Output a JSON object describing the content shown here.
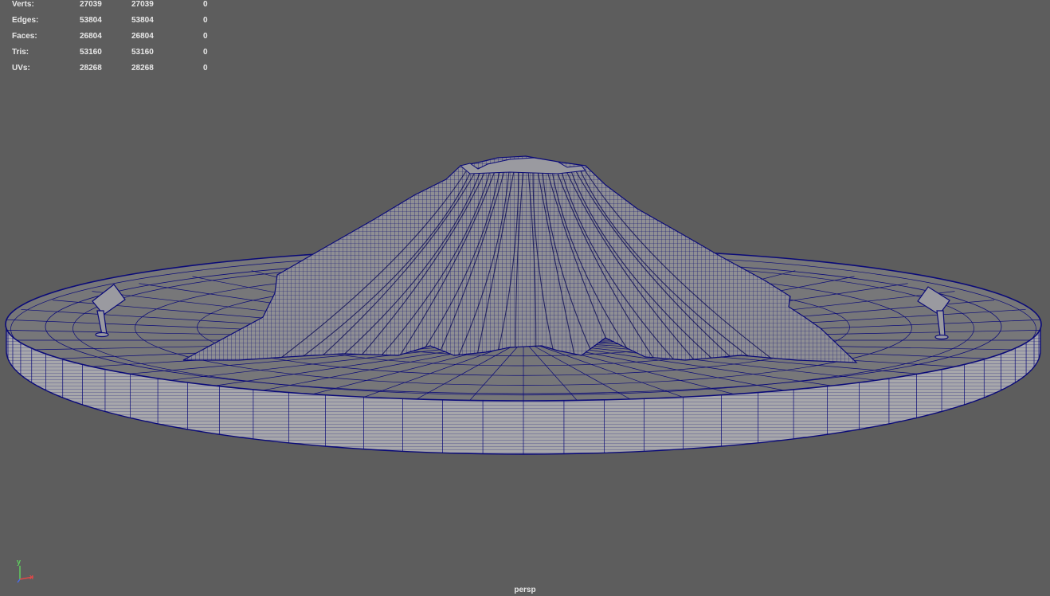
{
  "hud": {
    "rows": [
      {
        "label": "Verts:",
        "c1": "27039",
        "c2": "27039",
        "c3": "0"
      },
      {
        "label": "Edges:",
        "c1": "53804",
        "c2": "53804",
        "c3": "0"
      },
      {
        "label": "Faces:",
        "c1": "26804",
        "c2": "26804",
        "c3": "0"
      },
      {
        "label": "Tris:",
        "c1": "53160",
        "c2": "53160",
        "c3": "0"
      },
      {
        "label": "UVs:",
        "c1": "28268",
        "c2": "28268",
        "c3": "0"
      }
    ]
  },
  "viewport": {
    "camera_label": "persp",
    "background_color": "#5d5d5d",
    "wire_color": "#0a0a78",
    "surface_color": "#8c8c8c"
  },
  "axis": {
    "y_label": "y",
    "x_label": "x",
    "y_color": "#5fd35f",
    "x_color": "#e04848",
    "z_color": "#4a6cf0"
  }
}
